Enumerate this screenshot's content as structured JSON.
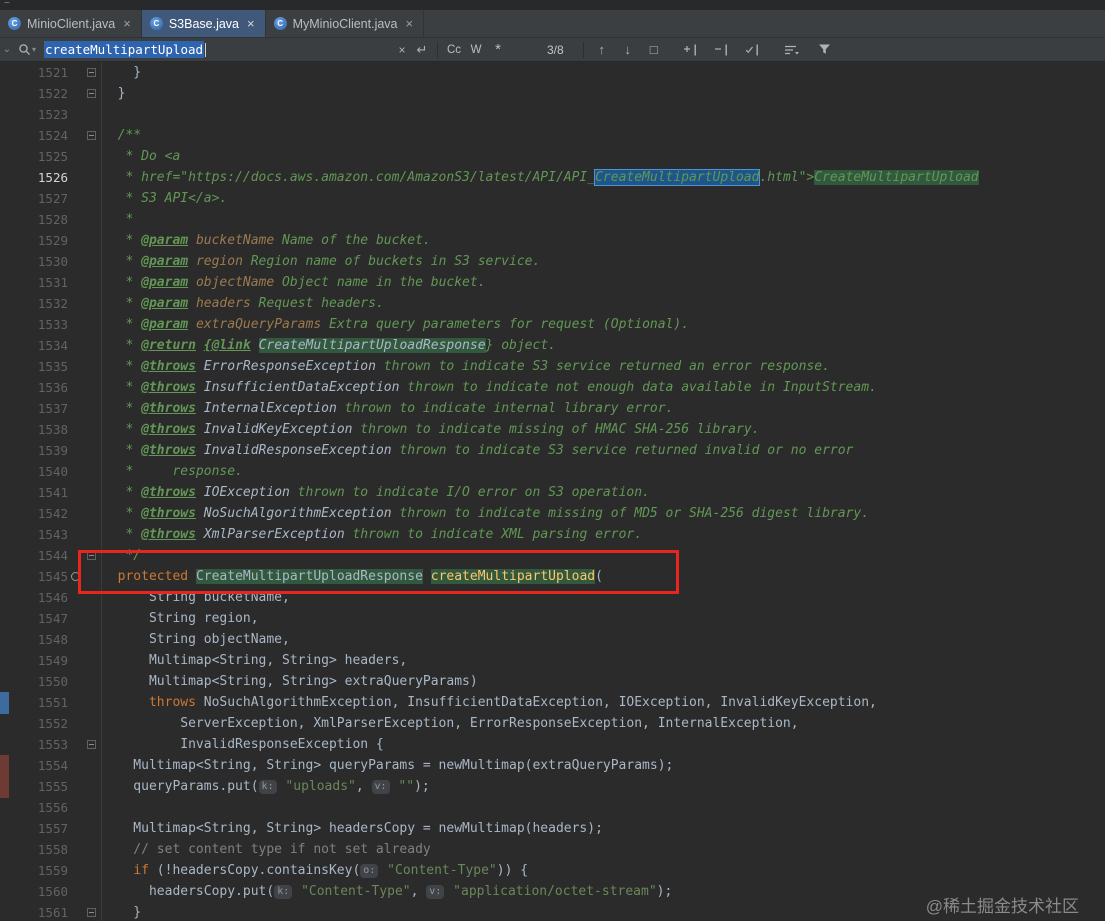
{
  "meta": {
    "watermark": "@稀土掘金技术社区"
  },
  "colors": {
    "background": "#2b2b2b",
    "match_current": "#1f5689",
    "match_result": "#32593d",
    "annotation_box": "#e8261f",
    "left_mark_blue": "#3d6ba0",
    "left_mark_maroon": "#6e3b34",
    "selection": "#2e64ad"
  },
  "tab_bar": {
    "icon_letter": "C",
    "close_glyph": "×",
    "tabs": [
      {
        "label": "MinioClient.java",
        "active": false
      },
      {
        "label": "S3Base.java",
        "active": true
      },
      {
        "label": "MyMinioClient.java",
        "active": false
      }
    ]
  },
  "find_bar": {
    "query": "createMultipartUpload",
    "match_count": "3/8",
    "match_case_label": "Cc",
    "words_label": "W",
    "regex_label": "*",
    "clear_glyph": "×",
    "newline_glyph": "↵",
    "prev_glyph": "↑",
    "next_glyph": "↓",
    "find_all_glyph": "□"
  },
  "editor": {
    "lines": [
      {
        "n": 1521,
        "fold": true,
        "toks": [
          {
            "t": "    }",
            "s": "p"
          }
        ]
      },
      {
        "n": 1522,
        "fold": true,
        "toks": [
          {
            "t": "  }",
            "s": "p"
          }
        ]
      },
      {
        "n": 1523,
        "toks": []
      },
      {
        "n": 1524,
        "fold": true,
        "toks": [
          {
            "t": "  /**",
            "s": "doc"
          }
        ]
      },
      {
        "n": 1525,
        "toks": [
          {
            "t": "   * Do <a",
            "s": "doc"
          }
        ]
      },
      {
        "n": 1526,
        "cur": true,
        "toks": [
          {
            "t": "   * href=\"https://docs.aws.amazon.com/AmazonS3/latest/API/API_",
            "s": "doc"
          },
          {
            "t": "CreateMultipartUpload",
            "s": "doc",
            "h": "cur"
          },
          {
            "t": ".html\">",
            "s": "doc"
          },
          {
            "t": "CreateMultipartUpload",
            "s": "doc",
            "h": "grn"
          }
        ]
      },
      {
        "n": 1527,
        "toks": [
          {
            "t": "   * S3 API</a>.",
            "s": "doc"
          }
        ]
      },
      {
        "n": 1528,
        "toks": [
          {
            "t": "   *",
            "s": "doc"
          }
        ]
      },
      {
        "n": 1529,
        "toks": [
          {
            "t": "   * ",
            "s": "doc"
          },
          {
            "t": "@param",
            "s": "tag"
          },
          {
            "t": " ",
            "s": "doc"
          },
          {
            "t": "bucketName",
            "s": "val"
          },
          {
            "t": " Name of the bucket.",
            "s": "doc"
          }
        ]
      },
      {
        "n": 1530,
        "toks": [
          {
            "t": "   * ",
            "s": "doc"
          },
          {
            "t": "@param",
            "s": "tag"
          },
          {
            "t": " ",
            "s": "doc"
          },
          {
            "t": "region",
            "s": "val"
          },
          {
            "t": " Region name of buckets in S3 service.",
            "s": "doc"
          }
        ]
      },
      {
        "n": 1531,
        "toks": [
          {
            "t": "   * ",
            "s": "doc"
          },
          {
            "t": "@param",
            "s": "tag"
          },
          {
            "t": " ",
            "s": "doc"
          },
          {
            "t": "objectName",
            "s": "val"
          },
          {
            "t": " Object name in the bucket.",
            "s": "doc"
          }
        ]
      },
      {
        "n": 1532,
        "toks": [
          {
            "t": "   * ",
            "s": "doc"
          },
          {
            "t": "@param",
            "s": "tag"
          },
          {
            "t": " ",
            "s": "doc"
          },
          {
            "t": "headers",
            "s": "val"
          },
          {
            "t": " Request headers.",
            "s": "doc"
          }
        ]
      },
      {
        "n": 1533,
        "toks": [
          {
            "t": "   * ",
            "s": "doc"
          },
          {
            "t": "@param",
            "s": "tag"
          },
          {
            "t": " ",
            "s": "doc"
          },
          {
            "t": "extraQueryParams",
            "s": "val"
          },
          {
            "t": " Extra query parameters for request (Optional).",
            "s": "doc"
          }
        ]
      },
      {
        "n": 1534,
        "toks": [
          {
            "t": "   * ",
            "s": "doc"
          },
          {
            "t": "@return",
            "s": "tag"
          },
          {
            "t": " ",
            "s": "doc"
          },
          {
            "t": "{@link",
            "s": "tag"
          },
          {
            "t": " ",
            "s": "doc"
          },
          {
            "t": "CreateMultipartUploadResponse",
            "s": "cls",
            "h": "grn"
          },
          {
            "t": "} object.",
            "s": "doc"
          }
        ]
      },
      {
        "n": 1535,
        "toks": [
          {
            "t": "   * ",
            "s": "doc"
          },
          {
            "t": "@throws",
            "s": "tag"
          },
          {
            "t": " ",
            "s": "doc"
          },
          {
            "t": "ErrorResponseException",
            "s": "cls"
          },
          {
            "t": " thrown to indicate S3 service returned an error response.",
            "s": "doc"
          }
        ]
      },
      {
        "n": 1536,
        "toks": [
          {
            "t": "   * ",
            "s": "doc"
          },
          {
            "t": "@throws",
            "s": "tag"
          },
          {
            "t": " ",
            "s": "doc"
          },
          {
            "t": "InsufficientDataException",
            "s": "cls"
          },
          {
            "t": " thrown to indicate not enough data available in InputStream.",
            "s": "doc"
          }
        ]
      },
      {
        "n": 1537,
        "toks": [
          {
            "t": "   * ",
            "s": "doc"
          },
          {
            "t": "@throws",
            "s": "tag"
          },
          {
            "t": " ",
            "s": "doc"
          },
          {
            "t": "InternalException",
            "s": "cls"
          },
          {
            "t": " thrown to indicate internal library error.",
            "s": "doc"
          }
        ]
      },
      {
        "n": 1538,
        "toks": [
          {
            "t": "   * ",
            "s": "doc"
          },
          {
            "t": "@throws",
            "s": "tag"
          },
          {
            "t": " ",
            "s": "doc"
          },
          {
            "t": "InvalidKeyException",
            "s": "cls"
          },
          {
            "t": " thrown to indicate missing of HMAC SHA-256 library.",
            "s": "doc"
          }
        ]
      },
      {
        "n": 1539,
        "toks": [
          {
            "t": "   * ",
            "s": "doc"
          },
          {
            "t": "@throws",
            "s": "tag"
          },
          {
            "t": " ",
            "s": "doc"
          },
          {
            "t": "InvalidResponseException",
            "s": "cls"
          },
          {
            "t": " thrown to indicate S3 service returned invalid or no error",
            "s": "doc"
          }
        ]
      },
      {
        "n": 1540,
        "toks": [
          {
            "t": "   *     response.",
            "s": "doc"
          }
        ]
      },
      {
        "n": 1541,
        "toks": [
          {
            "t": "   * ",
            "s": "doc"
          },
          {
            "t": "@throws",
            "s": "tag"
          },
          {
            "t": " ",
            "s": "doc"
          },
          {
            "t": "IOException",
            "s": "cls"
          },
          {
            "t": " thrown to indicate I/O error on S3 operation.",
            "s": "doc"
          }
        ]
      },
      {
        "n": 1542,
        "toks": [
          {
            "t": "   * ",
            "s": "doc"
          },
          {
            "t": "@throws",
            "s": "tag"
          },
          {
            "t": " ",
            "s": "doc"
          },
          {
            "t": "NoSuchAlgorithmException",
            "s": "cls"
          },
          {
            "t": " thrown to indicate missing of MD5 or SHA-256 digest library.",
            "s": "doc"
          }
        ]
      },
      {
        "n": 1543,
        "toks": [
          {
            "t": "   * ",
            "s": "doc"
          },
          {
            "t": "@throws",
            "s": "tag"
          },
          {
            "t": " ",
            "s": "doc"
          },
          {
            "t": "XmlParserException",
            "s": "cls"
          },
          {
            "t": " thrown to indicate XML parsing error.",
            "s": "doc"
          }
        ]
      },
      {
        "n": 1544,
        "fold": true,
        "toks": [
          {
            "t": "   */",
            "s": "doc"
          }
        ]
      },
      {
        "n": 1545,
        "icon": "override",
        "toks": [
          {
            "t": "  ",
            "s": "p"
          },
          {
            "t": "protected",
            "s": "kw"
          },
          {
            "t": " ",
            "s": "p"
          },
          {
            "t": "CreateMultipartUploadResponse",
            "s": "p",
            "h": "grn"
          },
          {
            "t": " ",
            "s": "p"
          },
          {
            "t": "createMultipartUpload",
            "s": "fn",
            "h": "grn"
          },
          {
            "t": "(",
            "s": "p"
          }
        ]
      },
      {
        "n": 1546,
        "toks": [
          {
            "t": "      String bucketName,",
            "s": "p"
          }
        ]
      },
      {
        "n": 1547,
        "toks": [
          {
            "t": "      String region,",
            "s": "p"
          }
        ]
      },
      {
        "n": 1548,
        "toks": [
          {
            "t": "      String objectName,",
            "s": "p"
          }
        ]
      },
      {
        "n": 1549,
        "toks": [
          {
            "t": "      Multimap<String, String> headers,",
            "s": "p"
          }
        ]
      },
      {
        "n": 1550,
        "toks": [
          {
            "t": "      Multimap<String, String> extraQueryParams)",
            "s": "p"
          }
        ]
      },
      {
        "n": 1551,
        "toks": [
          {
            "t": "      ",
            "s": "p"
          },
          {
            "t": "throws",
            "s": "kw"
          },
          {
            "t": " NoSuchAlgorithmException, InsufficientDataException, IOException, InvalidKeyException,",
            "s": "p"
          }
        ]
      },
      {
        "n": 1552,
        "toks": [
          {
            "t": "          ServerException, XmlParserException, ErrorResponseException, InternalException,",
            "s": "p"
          }
        ]
      },
      {
        "n": 1553,
        "fold": true,
        "toks": [
          {
            "t": "          InvalidResponseException {",
            "s": "p"
          }
        ]
      },
      {
        "n": 1554,
        "toks": [
          {
            "t": "    Multimap<String, String> queryParams = newMultimap(extraQueryParams);",
            "s": "p"
          }
        ]
      },
      {
        "n": 1555,
        "toks": [
          {
            "t": "    queryParams.put(",
            "s": "p"
          },
          {
            "t": "k:",
            "s": "hint"
          },
          {
            "t": " ",
            "s": "p"
          },
          {
            "t": "\"uploads\"",
            "s": "str"
          },
          {
            "t": ", ",
            "s": "p"
          },
          {
            "t": "v:",
            "s": "hint"
          },
          {
            "t": " ",
            "s": "p"
          },
          {
            "t": "\"\"",
            "s": "str"
          },
          {
            "t": ");",
            "s": "p"
          }
        ]
      },
      {
        "n": 1556,
        "toks": []
      },
      {
        "n": 1557,
        "toks": [
          {
            "t": "    Multimap<String, String> headersCopy = newMultimap(headers);",
            "s": "p"
          }
        ]
      },
      {
        "n": 1558,
        "toks": [
          {
            "t": "    // set content type if not set already",
            "s": "cmt"
          }
        ]
      },
      {
        "n": 1559,
        "toks": [
          {
            "t": "    ",
            "s": "p"
          },
          {
            "t": "if",
            "s": "kw"
          },
          {
            "t": " (!headersCopy.containsKey(",
            "s": "p"
          },
          {
            "t": "o:",
            "s": "hint"
          },
          {
            "t": " ",
            "s": "p"
          },
          {
            "t": "\"Content-Type\"",
            "s": "str"
          },
          {
            "t": ")) {",
            "s": "p"
          }
        ]
      },
      {
        "n": 1560,
        "toks": [
          {
            "t": "      headersCopy.put(",
            "s": "p"
          },
          {
            "t": "k:",
            "s": "hint"
          },
          {
            "t": " ",
            "s": "p"
          },
          {
            "t": "\"Content-Type\"",
            "s": "str"
          },
          {
            "t": ", ",
            "s": "p"
          },
          {
            "t": "v:",
            "s": "hint"
          },
          {
            "t": " ",
            "s": "p"
          },
          {
            "t": "\"application/octet-stream\"",
            "s": "str"
          },
          {
            "t": ");",
            "s": "p"
          }
        ]
      },
      {
        "n": 1561,
        "fold": true,
        "toks": [
          {
            "t": "    }",
            "s": "p"
          }
        ]
      }
    ]
  }
}
